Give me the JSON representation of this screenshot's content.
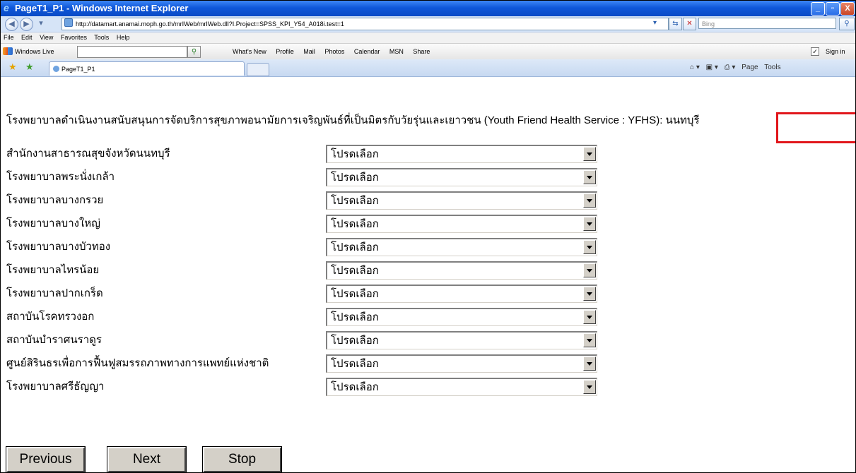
{
  "window": {
    "title": "PageT1_P1 - Windows Internet Explorer",
    "minimize_label": "_",
    "maximize_label": "▫",
    "close_label": "X"
  },
  "address": {
    "url": "http://datamart.anamai.moph.go.th/mrIWeb/mrIWeb.dll?I.Project=SPSS_KPI_Y54_A018i.test=1",
    "search_placeholder": "Bing"
  },
  "menu": [
    "File",
    "Edit",
    "View",
    "Favorites",
    "Tools",
    "Help"
  ],
  "live_bar": {
    "label": "Windows Live",
    "links": [
      "What's New",
      "Profile",
      "Mail",
      "Photos",
      "Calendar",
      "MSN",
      "Share"
    ],
    "sign_in": "Sign in"
  },
  "tab": {
    "label": "PageT1_P1"
  },
  "commands": [
    "Page",
    "Tools"
  ],
  "page": {
    "heading": "โรงพยาบาลดำเนินงานสนับสนุนการจัดบริการสุขภาพอนามัยการเจริญพันธ์ที่เป็นมิตรกับวัยรุ่นและเยาวชน (Youth Friend Health Service : YFHS): นนทบุรี",
    "rows": [
      {
        "label": "สำนักงานสาธารณสุขจังหวัดนนทบุรี",
        "value": "โปรดเลือก"
      },
      {
        "label": "โรงพยาบาลพระนั่งเกล้า",
        "value": "โปรดเลือก"
      },
      {
        "label": "โรงพยาบาลบางกรวย",
        "value": "โปรดเลือก"
      },
      {
        "label": "โรงพยาบาลบางใหญ่",
        "value": "โปรดเลือก"
      },
      {
        "label": "โรงพยาบาลบางบัวทอง",
        "value": "โปรดเลือก"
      },
      {
        "label": "โรงพยาบาลไทรน้อย",
        "value": "โปรดเลือก"
      },
      {
        "label": "โรงพยาบาลปากเกร็ด",
        "value": "โปรดเลือก"
      },
      {
        "label": "สถาบันโรคทรวงอก",
        "value": "โปรดเลือก"
      },
      {
        "label": "สถาบันบำราศนราดูร",
        "value": "โปรดเลือก"
      },
      {
        "label": "ศูนย์สิรินธรเพื่อการฟื้นฟูสมรรถภาพทางการแพทย์แห่งชาติ",
        "value": "โปรดเลือก"
      },
      {
        "label": "โรงพยาบาลศรีธัญญา",
        "value": "โปรดเลือก"
      }
    ],
    "buttons": {
      "previous": "Previous",
      "next": "Next",
      "stop": "Stop"
    }
  },
  "colors": {
    "titlebar": "#0f57d9",
    "highlight_box": "#e1161b"
  }
}
